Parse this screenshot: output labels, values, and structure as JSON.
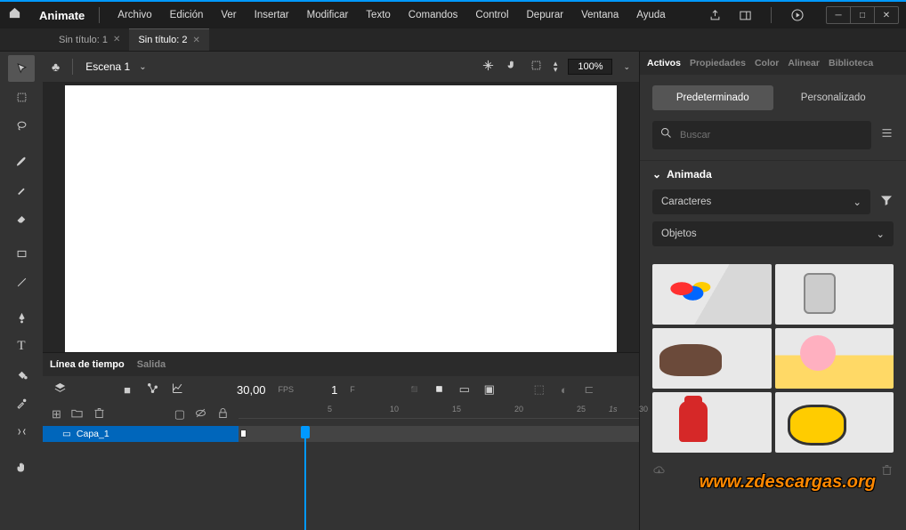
{
  "app": {
    "name": "Animate"
  },
  "menus": [
    "Archivo",
    "Edición",
    "Ver",
    "Insertar",
    "Modificar",
    "Texto",
    "Comandos",
    "Control",
    "Depurar",
    "Ventana",
    "Ayuda"
  ],
  "docs": [
    {
      "title": "Sin título: 1",
      "active": false
    },
    {
      "title": "Sin título: 2",
      "active": true
    }
  ],
  "scene": {
    "name": "Escena 1",
    "zoom": "100%"
  },
  "timeline": {
    "tabs": [
      "Línea de tiempo",
      "Salida"
    ],
    "fps": "30,00",
    "fps_label": "FPS",
    "frame": "1",
    "frame_label": "F",
    "layer": "Capa_1",
    "ticks": [
      5,
      10,
      15,
      20,
      25,
      30
    ],
    "sec_label": "1s"
  },
  "right": {
    "tabs": [
      "Activos",
      "Propiedades",
      "Color",
      "Alinear",
      "Biblioteca"
    ],
    "toggle": {
      "a": "Predeterminado",
      "b": "Personalizado"
    },
    "search_placeholder": "Buscar",
    "section_title": "Animada",
    "dd1": "Caracteres",
    "dd2": "Objetos"
  },
  "watermark": "www.zdescargas.org"
}
